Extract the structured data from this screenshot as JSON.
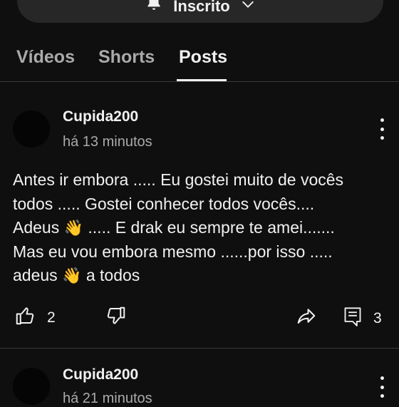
{
  "subscribe": {
    "label": "Inscrito"
  },
  "tabs": [
    {
      "label": "Vídeos",
      "active": false
    },
    {
      "label": "Shorts",
      "active": false
    },
    {
      "label": "Posts",
      "active": true
    }
  ],
  "posts": [
    {
      "author": "Cupida200",
      "time": "há 13 minutos",
      "lines": [
        [
          "Antes ir embora ..... Eu gostei muito de vocês"
        ],
        [
          "todos .....  Gostei conhecer todos vocês...."
        ],
        [
          "Adeus ",
          "👋",
          " .....  E drak eu sempre te amei......."
        ],
        [
          "Mas eu vou embora mesmo ......por isso ....."
        ],
        [
          "adeus ",
          "👋",
          " a   todos"
        ]
      ],
      "likes": "2",
      "comments": "3"
    },
    {
      "author": "Cupida200",
      "time": "há 21 minutos"
    }
  ],
  "icons": [
    "bell-icon",
    "chevron-down-icon",
    "more-vert-icon",
    "thumbs-up-icon",
    "thumbs-down-icon",
    "share-icon",
    "comment-icon"
  ]
}
